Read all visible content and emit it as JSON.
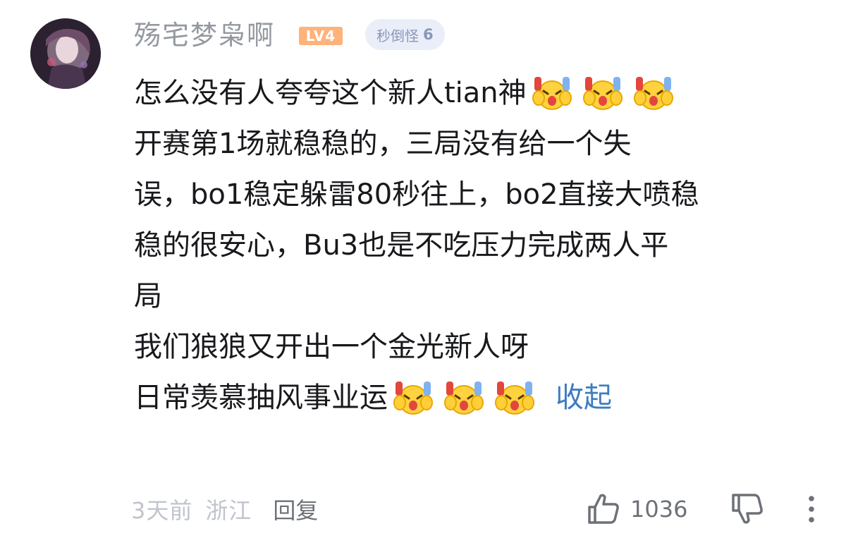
{
  "comment": {
    "username": "殇宅梦枭啊",
    "level_badge": "LV4",
    "fan_badge": {
      "name": "秒倒怪",
      "level": "6"
    },
    "lines": [
      "怎么没有人夸夸这个新人tian神",
      "开赛第1场就稳稳的，三局没有给一个失",
      "误，bo1稳定躲雷80秒往上，bo2直接大喷稳",
      "稳的很安心，Bu3也是不吃压力完成两人平",
      "局",
      "我们狼狼又开出一个金光新人呀",
      "日常羡慕抽风事业运"
    ],
    "emoji_name": "laugh-cry-hands-up-emoji",
    "collapse_label": "收起",
    "time": "3天前",
    "region": "浙江",
    "reply_label": "回复",
    "like_count": "1036",
    "colors": {
      "username": "#9499a0",
      "level_badge": "#ffb27a",
      "fan_badge_bg": "#e9eef9",
      "link": "#3d7dbf",
      "meta": "#c0c4cc",
      "text": "#18191c"
    },
    "icons": {
      "like": "thumb-up-icon",
      "dislike": "thumb-down-icon",
      "more": "more-vertical-icon"
    }
  }
}
